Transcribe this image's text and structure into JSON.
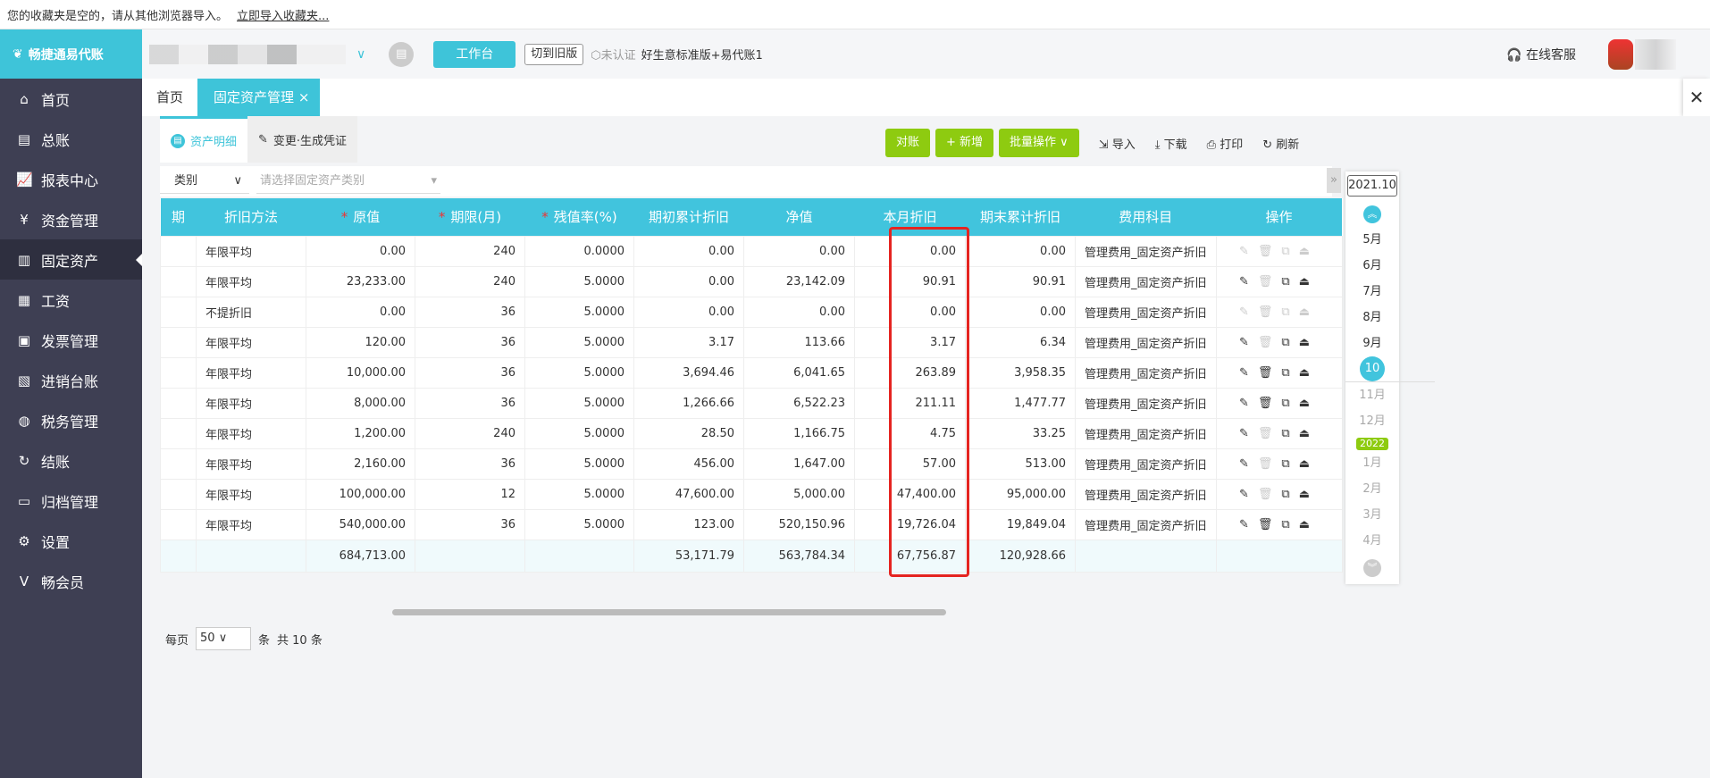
{
  "favbar": {
    "text": "您的收藏夹是空的，请从其他浏览器导入。",
    "link": "立即导入收藏夹..."
  },
  "logo": "畅捷通易代账",
  "sidebar": [
    {
      "icon": "home-icon",
      "glyph": "⌂",
      "label": "首页"
    },
    {
      "icon": "ledger-icon",
      "glyph": "▤",
      "label": "总账"
    },
    {
      "icon": "chart-icon",
      "glyph": "📈",
      "label": "报表中心"
    },
    {
      "icon": "money-icon",
      "glyph": "¥",
      "label": "资金管理"
    },
    {
      "icon": "asset-icon",
      "glyph": "▥",
      "label": "固定资产",
      "active": true
    },
    {
      "icon": "salary-icon",
      "glyph": "▦",
      "label": "工资"
    },
    {
      "icon": "invoice-icon",
      "glyph": "▣",
      "label": "发票管理"
    },
    {
      "icon": "stock-icon",
      "glyph": "▧",
      "label": "进销台账"
    },
    {
      "icon": "tax-icon",
      "glyph": "◍",
      "label": "税务管理"
    },
    {
      "icon": "close-account-icon",
      "glyph": "↻",
      "label": "结账"
    },
    {
      "icon": "archive-icon",
      "glyph": "▭",
      "label": "归档管理"
    },
    {
      "icon": "settings-icon",
      "glyph": "⚙",
      "label": "设置"
    },
    {
      "icon": "vip-icon",
      "glyph": "V",
      "label": "畅会员"
    }
  ],
  "topbar": {
    "workbench": "工作台",
    "switch_old": "切到旧版",
    "cert": "未认证",
    "edition": "好生意标准版+易代账1",
    "service": "在线客服"
  },
  "tabs": {
    "home": "首页",
    "active": "固定资产管理",
    "close": "×"
  },
  "subtabs": [
    "资产明细",
    "变更·生成凭证"
  ],
  "toolbar": {
    "reconcile": "对账",
    "add": "+ 新增",
    "batch": "批量操作 ∨",
    "import": "导入",
    "download": "下载",
    "print": "打印",
    "refresh": "刷新"
  },
  "filter": {
    "category": "类别",
    "placeholder": "请选择固定资产类别"
  },
  "table": {
    "headers": [
      "期",
      "折旧方法",
      "原值",
      "期限(月)",
      "残值率(%)",
      "期初累计折旧",
      "净值",
      "本月折旧",
      "期末累计折旧",
      "费用科目",
      "操作"
    ],
    "rows": [
      [
        "",
        "年限平均",
        "0.00",
        "240",
        "0.0000",
        "0.00",
        "0.00",
        "0.00",
        "0.00",
        "管理费用_固定资产折旧"
      ],
      [
        "",
        "年限平均",
        "23,233.00",
        "240",
        "5.0000",
        "0.00",
        "23,142.09",
        "90.91",
        "90.91",
        "管理费用_固定资产折旧"
      ],
      [
        "",
        "不提折旧",
        "0.00",
        "36",
        "5.0000",
        "0.00",
        "0.00",
        "0.00",
        "0.00",
        "管理费用_固定资产折旧"
      ],
      [
        "",
        "年限平均",
        "120.00",
        "36",
        "5.0000",
        "3.17",
        "113.66",
        "3.17",
        "6.34",
        "管理费用_固定资产折旧"
      ],
      [
        "",
        "年限平均",
        "10,000.00",
        "36",
        "5.0000",
        "3,694.46",
        "6,041.65",
        "263.89",
        "3,958.35",
        "管理费用_固定资产折旧"
      ],
      [
        "",
        "年限平均",
        "8,000.00",
        "36",
        "5.0000",
        "1,266.66",
        "6,522.23",
        "211.11",
        "1,477.77",
        "管理费用_固定资产折旧"
      ],
      [
        "",
        "年限平均",
        "1,200.00",
        "240",
        "5.0000",
        "28.50",
        "1,166.75",
        "4.75",
        "33.25",
        "管理费用_固定资产折旧"
      ],
      [
        "",
        "年限平均",
        "2,160.00",
        "36",
        "5.0000",
        "456.00",
        "1,647.00",
        "57.00",
        "513.00",
        "管理费用_固定资产折旧"
      ],
      [
        "",
        "年限平均",
        "100,000.00",
        "12",
        "5.0000",
        "47,600.00",
        "5,000.00",
        "47,400.00",
        "95,000.00",
        "管理费用_固定资产折旧"
      ],
      [
        "",
        "年限平均",
        "540,000.00",
        "36",
        "5.0000",
        "123.00",
        "520,150.96",
        "19,726.04",
        "19,849.04",
        "管理费用_固定资产折旧"
      ]
    ],
    "ops_enabled": [
      false,
      true,
      false,
      true,
      true,
      true,
      true,
      true,
      true,
      true
    ],
    "delete_enabled": [
      false,
      false,
      false,
      false,
      true,
      true,
      false,
      false,
      false,
      true
    ],
    "total": [
      "",
      "",
      "684,713.00",
      "",
      "",
      "53,171.79",
      "563,784.34",
      "67,756.87",
      "120,928.66",
      ""
    ]
  },
  "pager": {
    "per_page_label": "每页",
    "per_page": "50",
    "unit": "条",
    "total": "共 10 条"
  },
  "calendar": {
    "year_month": "2021.10",
    "months": [
      "5月",
      "6月",
      "7月",
      "8月",
      "9月",
      "10月",
      "11月",
      "12月"
    ],
    "next_year": "2022",
    "next_months": [
      "1月",
      "2月",
      "3月",
      "4月"
    ],
    "selected": "10月"
  }
}
